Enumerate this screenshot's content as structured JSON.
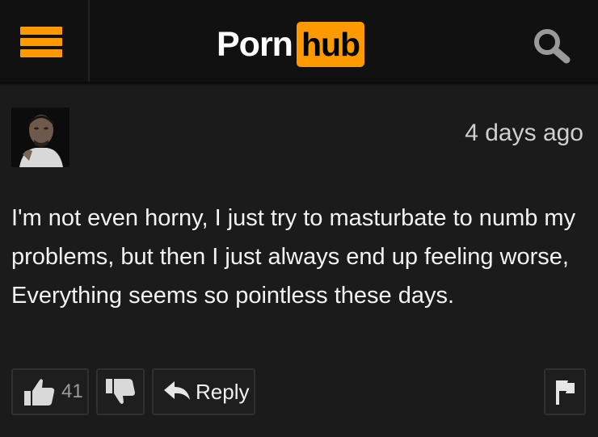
{
  "header": {
    "logo_left": "Porn",
    "logo_right": "hub",
    "brand_color": "#ff9900",
    "menu_icon": "hamburger-icon",
    "search_icon": "search-icon"
  },
  "comment": {
    "avatar": "user-avatar",
    "timestamp": "4 days ago",
    "text": "I'm not even horny, I just try to masturbate to numb my problems, but then I just always end up feeling worse, Everything seems so pointless these days."
  },
  "actions": {
    "like_icon": "thumbs-up-icon",
    "like_count": "41",
    "dislike_icon": "thumbs-down-icon",
    "reply_icon": "reply-arrow-icon",
    "reply_label": "Reply",
    "flag_icon": "flag-icon"
  }
}
